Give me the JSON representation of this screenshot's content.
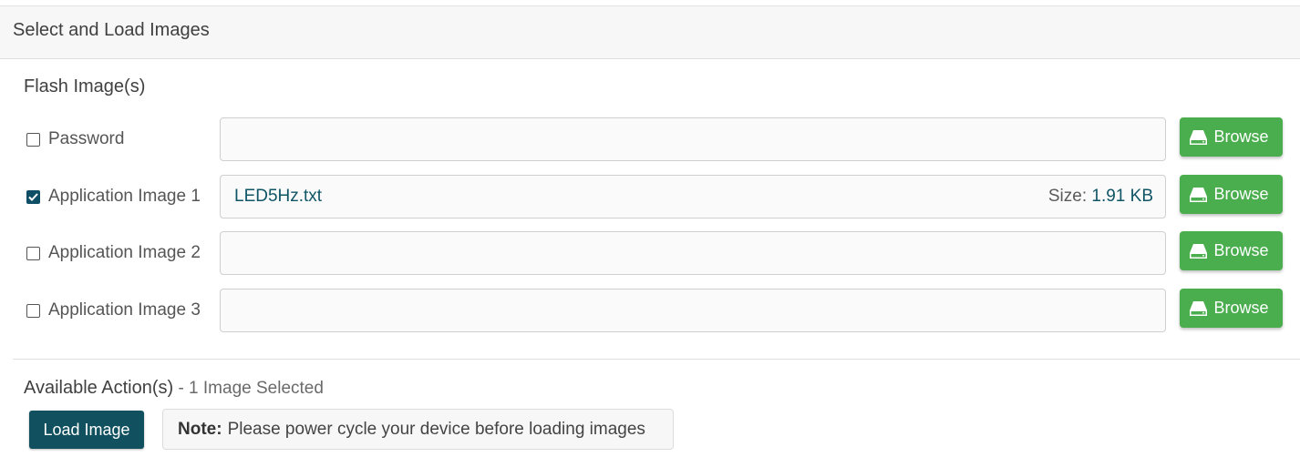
{
  "panel": {
    "title": "Select and Load Images"
  },
  "flash": {
    "title": "Flash Image(s)",
    "browse_label": "Browse",
    "rows": [
      {
        "label": "Password",
        "checked": false,
        "file_name": "",
        "size_label": "",
        "size_value": ""
      },
      {
        "label": "Application Image 1",
        "checked": true,
        "file_name": "LED5Hz.txt",
        "size_label": "Size:",
        "size_value": "1.91 KB"
      },
      {
        "label": "Application Image 2",
        "checked": false,
        "file_name": "",
        "size_label": "",
        "size_value": ""
      },
      {
        "label": "Application Image 3",
        "checked": false,
        "file_name": "",
        "size_label": "",
        "size_value": ""
      }
    ]
  },
  "actions": {
    "title": "Available Action(s)",
    "subtitle": " - 1 Image Selected",
    "load_label": "Load Image",
    "note_label": "Note:",
    "note_text": "Please power cycle your device before loading images"
  },
  "colors": {
    "browse": "#4aad4e",
    "primary": "#10505f",
    "checkbox_checked": "#0f4f66"
  }
}
